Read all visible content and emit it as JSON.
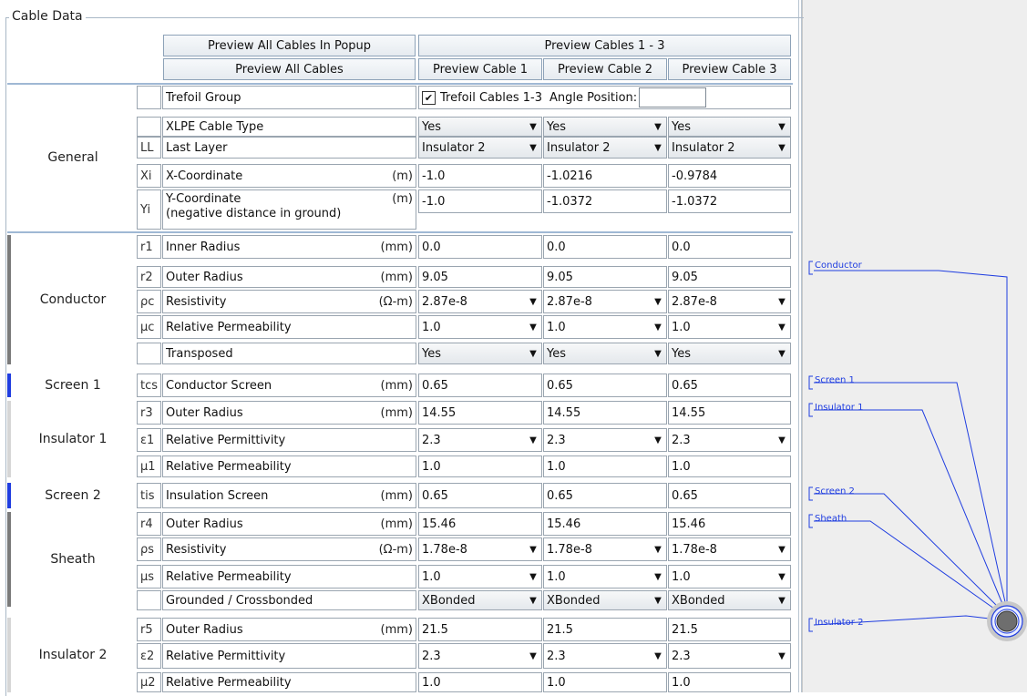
{
  "title": "Cable Data",
  "header": {
    "preview_all_popup": "Preview All Cables In Popup",
    "preview_all": "Preview All Cables",
    "preview_1_3": "Preview Cables 1 - 3",
    "preview_c1": "Preview Cable 1",
    "preview_c2": "Preview Cable 2",
    "preview_c3": "Preview Cable 3"
  },
  "sections": {
    "general": "General",
    "conductor": "Conductor",
    "screen1": "Screen 1",
    "insulator1": "Insulator 1",
    "screen2": "Screen 2",
    "sheath": "Sheath",
    "insulator2": "Insulator 2"
  },
  "rows": {
    "trefoil": {
      "label": "Trefoil Group",
      "check_label": "Trefoil Cables 1-3",
      "checked": true,
      "angle_label": "Angle Position:",
      "angle_value": ""
    },
    "xlpe": {
      "label": "XLPE Cable Type",
      "values": [
        "Yes",
        "Yes",
        "Yes"
      ]
    },
    "last_layer": {
      "sym": "LL",
      "label": "Last Layer",
      "values": [
        "Insulator 2",
        "Insulator 2",
        "Insulator 2"
      ]
    },
    "x_coord": {
      "sym": "Xi",
      "label": "X-Coordinate",
      "unit": "(m)",
      "values": [
        "-1.0",
        "-1.0216",
        "-0.9784"
      ]
    },
    "y_coord": {
      "sym": "Yi",
      "label": "Y-Coordinate",
      "label2": "(negative distance in ground)",
      "unit": "(m)",
      "values": [
        "-1.0",
        "-1.0372",
        "-1.0372"
      ]
    },
    "r1": {
      "sym": "r1",
      "label": "Inner Radius",
      "unit": "(mm)",
      "values": [
        "0.0",
        "0.0",
        "0.0"
      ]
    },
    "r2": {
      "sym": "r2",
      "label": "Outer Radius",
      "unit": "(mm)",
      "values": [
        "9.05",
        "9.05",
        "9.05"
      ]
    },
    "rho_c": {
      "sym": "ρc",
      "label": "Resistivity",
      "unit": "(Ω-m)",
      "values": [
        "2.87e-8",
        "2.87e-8",
        "2.87e-8"
      ]
    },
    "mu_c": {
      "sym": "µc",
      "label": "Relative Permeability",
      "values": [
        "1.0",
        "1.0",
        "1.0"
      ]
    },
    "transposed": {
      "label": "Transposed",
      "values": [
        "Yes",
        "Yes",
        "Yes"
      ]
    },
    "tcs": {
      "sym": "tcs",
      "label": "Conductor Screen",
      "unit": "(mm)",
      "values": [
        "0.65",
        "0.65",
        "0.65"
      ]
    },
    "r3": {
      "sym": "r3",
      "label": "Outer Radius",
      "unit": "(mm)",
      "values": [
        "14.55",
        "14.55",
        "14.55"
      ]
    },
    "eps1": {
      "sym": "ε1",
      "label": "Relative Permittivity",
      "values": [
        "2.3",
        "2.3",
        "2.3"
      ]
    },
    "mu1": {
      "sym": "µ1",
      "label": "Relative Permeability",
      "values": [
        "1.0",
        "1.0",
        "1.0"
      ]
    },
    "tis": {
      "sym": "tis",
      "label": "Insulation Screen",
      "unit": "(mm)",
      "values": [
        "0.65",
        "0.65",
        "0.65"
      ]
    },
    "r4": {
      "sym": "r4",
      "label": "Outer Radius",
      "unit": "(mm)",
      "values": [
        "15.46",
        "15.46",
        "15.46"
      ]
    },
    "rho_s": {
      "sym": "ρs",
      "label": "Resistivity",
      "unit": "(Ω-m)",
      "values": [
        "1.78e-8",
        "1.78e-8",
        "1.78e-8"
      ]
    },
    "mu_s": {
      "sym": "µs",
      "label": "Relative Permeability",
      "values": [
        "1.0",
        "1.0",
        "1.0"
      ]
    },
    "grounded": {
      "label": "Grounded / Crossbonded",
      "values": [
        "XBonded",
        "XBonded",
        "XBonded"
      ]
    },
    "r5": {
      "sym": "r5",
      "label": "Outer Radius",
      "unit": "(mm)",
      "values": [
        "21.5",
        "21.5",
        "21.5"
      ]
    },
    "eps2": {
      "sym": "ε2",
      "label": "Relative Permittivity",
      "values": [
        "2.3",
        "2.3",
        "2.3"
      ]
    },
    "mu2": {
      "sym": "µ2",
      "label": "Relative Permeability",
      "values": [
        "1.0",
        "1.0",
        "1.0"
      ]
    }
  },
  "diagram": {
    "labels": [
      "Conductor",
      "Screen 1",
      "Insulator 1",
      "Screen 2",
      "Sheath",
      "Insulator 2"
    ],
    "line_color": "#1f3de0"
  },
  "colors": {
    "section_bar_gray": "#7a7a7a",
    "section_bar_blue": "#1f3de0",
    "section_bar_light": "#d6d6d6"
  }
}
